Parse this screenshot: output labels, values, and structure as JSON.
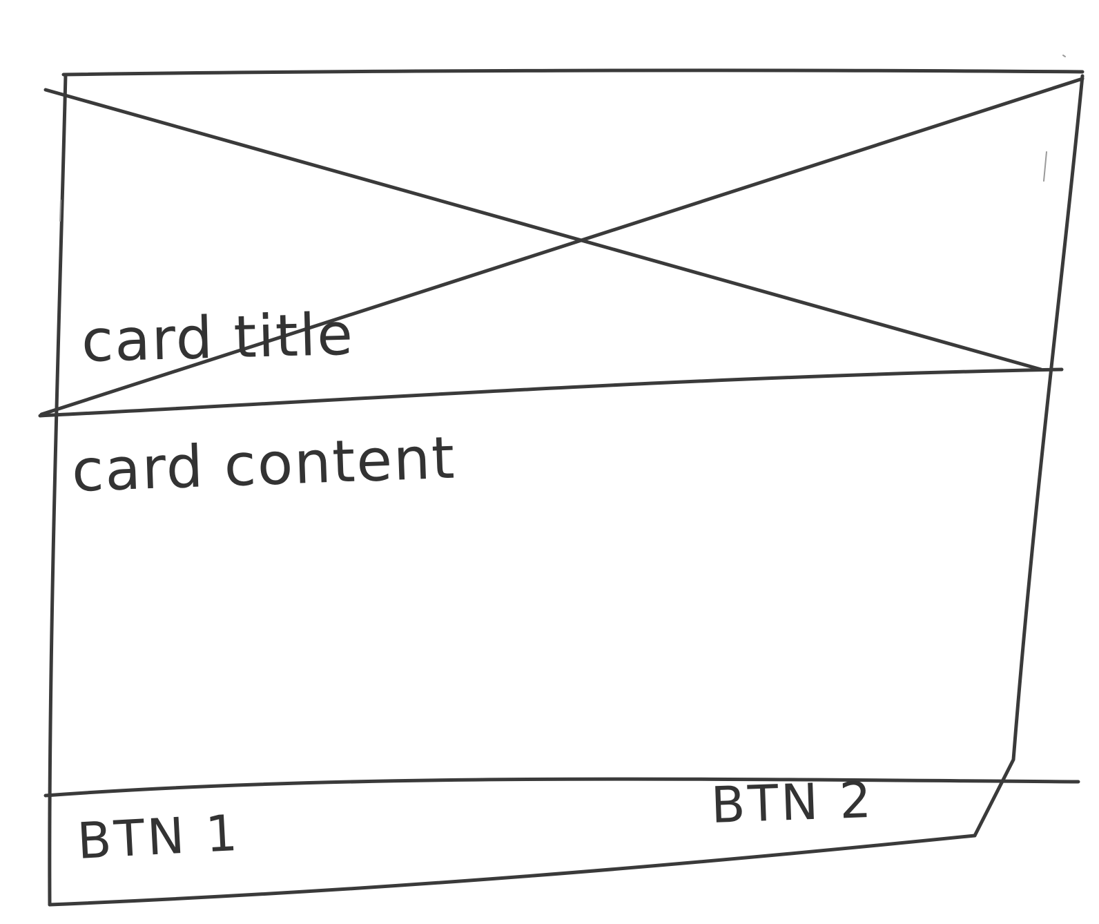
{
  "card": {
    "title": "card title",
    "content": "card content",
    "buttons": {
      "primary": "BTN 1",
      "secondary": "BTN 2"
    }
  },
  "colors": {
    "ink": "#3a3a3a",
    "paper": "#ffffff"
  }
}
